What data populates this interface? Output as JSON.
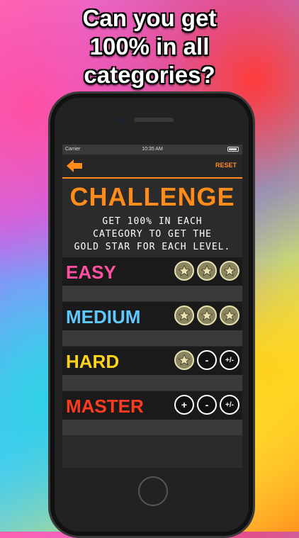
{
  "headline": [
    "Can you get",
    "100% in all",
    "categories?"
  ],
  "status": {
    "carrier": "Carrier",
    "time": "10:35 AM"
  },
  "nav": {
    "reset_label": "RESET"
  },
  "title": "CHALLENGE",
  "subtitle": [
    "GET 100% IN EACH",
    "CATEGORY TO GET THE",
    "GOLD STAR FOR EACH LEVEL."
  ],
  "levels": [
    {
      "label": "EASY",
      "color": "#ff4fa3",
      "icons": [
        "star",
        "star",
        "star"
      ]
    },
    {
      "label": "MEDIUM",
      "color": "#5ec8ff",
      "icons": [
        "star",
        "star",
        "star"
      ]
    },
    {
      "label": "HARD",
      "color": "#ffd21c",
      "icons": [
        "star",
        "minus",
        "plus-minus"
      ]
    },
    {
      "label": "MASTER",
      "color": "#ff3b1f",
      "icons": [
        "plus",
        "minus",
        "plus-minus"
      ]
    }
  ],
  "icon_glyphs": {
    "star": "★",
    "minus": "-",
    "plus": "+",
    "plus-minus": "+/-"
  },
  "colors": {
    "accent": "#ff8c1a",
    "star_fill": "#8a8460",
    "star_border": "#e8e2b0"
  }
}
